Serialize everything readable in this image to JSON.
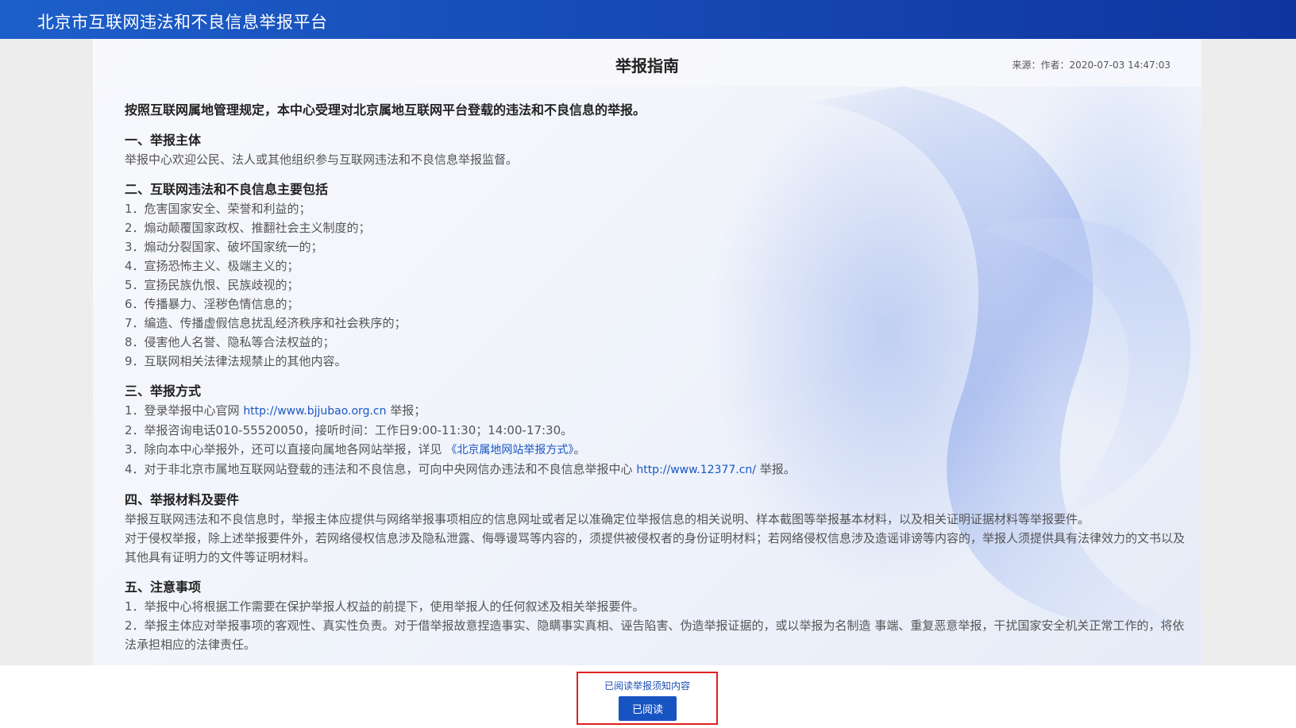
{
  "header": {
    "title": "北京市互联网违法和不良信息举报平台"
  },
  "doc": {
    "title": "举报指南",
    "meta": "来源：作者：2020-07-03 14:47:03",
    "lead": "按照互联网属地管理规定，本中心受理对北京属地互联网平台登载的违法和不良信息的举报。",
    "s1": {
      "heading": "一、举报主体",
      "text": "举报中心欢迎公民、法人或其他组织参与互联网违法和不良信息举报监督。"
    },
    "s2": {
      "heading": "二、互联网违法和不良信息主要包括",
      "items": [
        "1．危害国家安全、荣誉和利益的；",
        "2．煽动颠覆国家政权、推翻社会主义制度的；",
        "3．煽动分裂国家、破坏国家统一的；",
        "4．宣扬恐怖主义、极端主义的；",
        "5．宣扬民族仇恨、民族歧视的；",
        "6．传播暴力、淫秽色情信息的；",
        "7．编造、传播虚假信息扰乱经济秩序和社会秩序的；",
        "8．侵害他人名誉、隐私等合法权益的；",
        "9．互联网相关法律法规禁止的其他内容。"
      ]
    },
    "s3": {
      "heading": "三、举报方式",
      "item1_pre": "1．登录举报中心官网 ",
      "item1_link": "http://www.bjjubao.org.cn",
      "item1_post": " 举报；",
      "item2": "2．举报咨询电话010-55520050，接听时间：工作日9:00-11:30；14:00-17:30。",
      "item3_pre": "3．除向本中心举报外，还可以直接向属地各网站举报，详见 ",
      "item3_link": "《北京属地网站举报方式》",
      "item3_post": "。",
      "item4_pre": "4．对于非北京市属地互联网站登载的违法和不良信息，可向中央网信办违法和不良信息举报中心 ",
      "item4_link": "http://www.12377.cn/",
      "item4_post": " 举报。"
    },
    "s4": {
      "heading": "四、举报材料及要件",
      "p1": "举报互联网违法和不良信息时，举报主体应提供与网络举报事项相应的信息网址或者足以准确定位举报信息的相关说明、样本截图等举报基本材料，以及相关证明证据材料等举报要件。",
      "p2": "对于侵权举报，除上述举报要件外，若网络侵权信息涉及隐私泄露、侮辱谩骂等内容的，须提供被侵权者的身份证明材料；若网络侵权信息涉及造谣诽谤等内容的，举报人须提供具有法律效力的文书以及其他具有证明力的文件等证明材料。"
    },
    "s5": {
      "heading": "五、注意事项",
      "item1": "1．举报中心将根据工作需要在保护举报人权益的前提下，使用举报人的任何叙述及相关举报要件。",
      "item2": "2．举报主体应对举报事项的客观性、真实性负责。对于借举报故意捏造事实、隐瞒事实真相、诬告陷害、伪造举报证据的，或以举报为名制造 事端、重复恶意举报，干扰国家安全机关正常工作的，将依法承担相应的法律责任。"
    }
  },
  "confirm": {
    "notice": "已阅读举报须知内容",
    "button": "已阅读"
  }
}
